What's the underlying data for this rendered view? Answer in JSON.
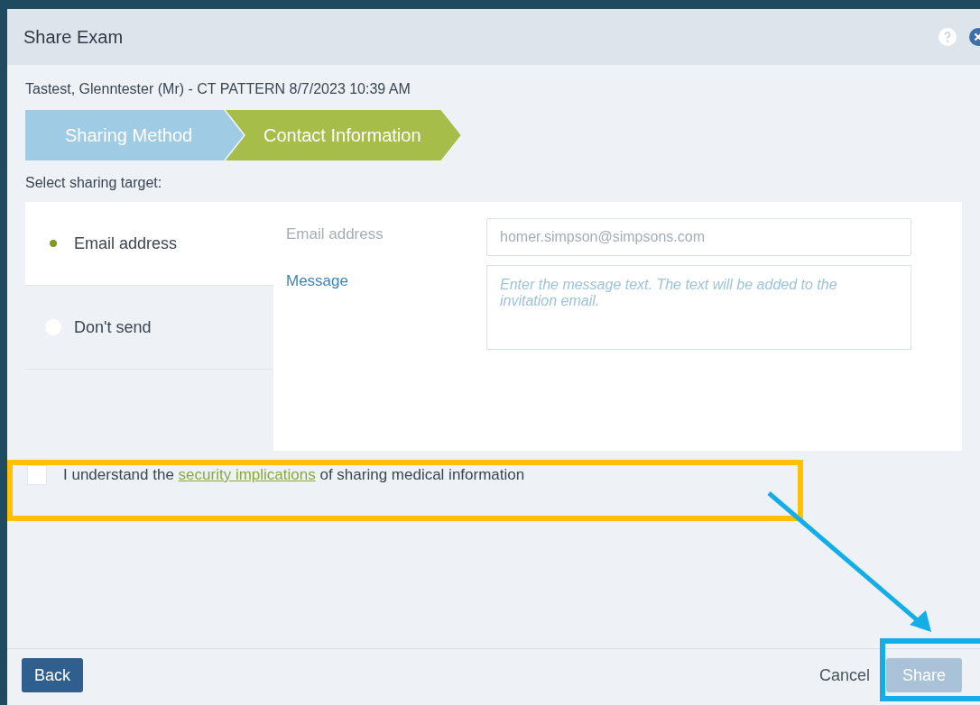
{
  "dialog": {
    "title": "Share Exam"
  },
  "exam_summary": "Tastest, Glenntester (Mr) - CT PATTERN 8/7/2023 10:39 AM",
  "steps": [
    {
      "label": "Sharing Method",
      "selected": false
    },
    {
      "label": "Contact Information",
      "selected": true
    }
  ],
  "target_prompt": "Select sharing target:",
  "targets": [
    {
      "label": "Email address",
      "selected": true
    },
    {
      "label": "Don't send",
      "selected": false
    }
  ],
  "fields": [
    {
      "kind": "input",
      "label": "Email address",
      "value": "homer.simpson@simpsons.com",
      "disabled": true
    },
    {
      "kind": "textarea",
      "label": "Message",
      "placeholder": "Enter the message text. The text will be added to the invitation email.",
      "disabled": false
    }
  ],
  "acknowledgement": {
    "checked": false,
    "before": "I understand the",
    "link": "security implications",
    "after": "of sharing medical information"
  },
  "buttons": [
    {
      "kind": "back",
      "label": "Back"
    },
    {
      "kind": "cancel",
      "label": "Cancel"
    },
    {
      "kind": "share",
      "label": "Share",
      "disabled": true
    }
  ]
}
